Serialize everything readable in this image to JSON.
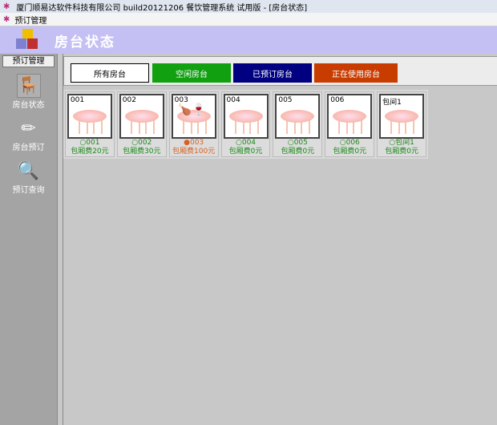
{
  "titlebar": {
    "title": "厦门顺易达软件科技有限公司  build20121206 餐饮管理系统   试用版 - [房台状态]"
  },
  "menu": {
    "item": "预订管理"
  },
  "header": {
    "title": "房台状态"
  },
  "sidebar": {
    "caption": "预订管理",
    "items": [
      {
        "label": "房台状态"
      },
      {
        "label": "房台预订"
      },
      {
        "label": "预订查询"
      }
    ]
  },
  "filters": [
    {
      "label": "所有房台",
      "color": "#ffffff"
    },
    {
      "label": "空闲房台",
      "color": "#10a010"
    },
    {
      "label": "已预订房台",
      "color": "#000080"
    },
    {
      "label": "正在使用房台",
      "color": "#c83c00"
    }
  ],
  "rooms": [
    {
      "code": "001",
      "status": "○",
      "fee": "包厢费20元",
      "busy": false
    },
    {
      "code": "002",
      "status": "○",
      "fee": "包厢费30元",
      "busy": false
    },
    {
      "code": "003",
      "status": "●",
      "fee": "包厢费100元",
      "busy": true
    },
    {
      "code": "004",
      "status": "○",
      "fee": "包厢费0元",
      "busy": false
    },
    {
      "code": "005",
      "status": "○",
      "fee": "包厢费0元",
      "busy": false
    },
    {
      "code": "006",
      "status": "○",
      "fee": "包厢费0元",
      "busy": false
    },
    {
      "code": "包间1",
      "status": "○",
      "fee": "包厢费0元",
      "busy": false
    }
  ]
}
